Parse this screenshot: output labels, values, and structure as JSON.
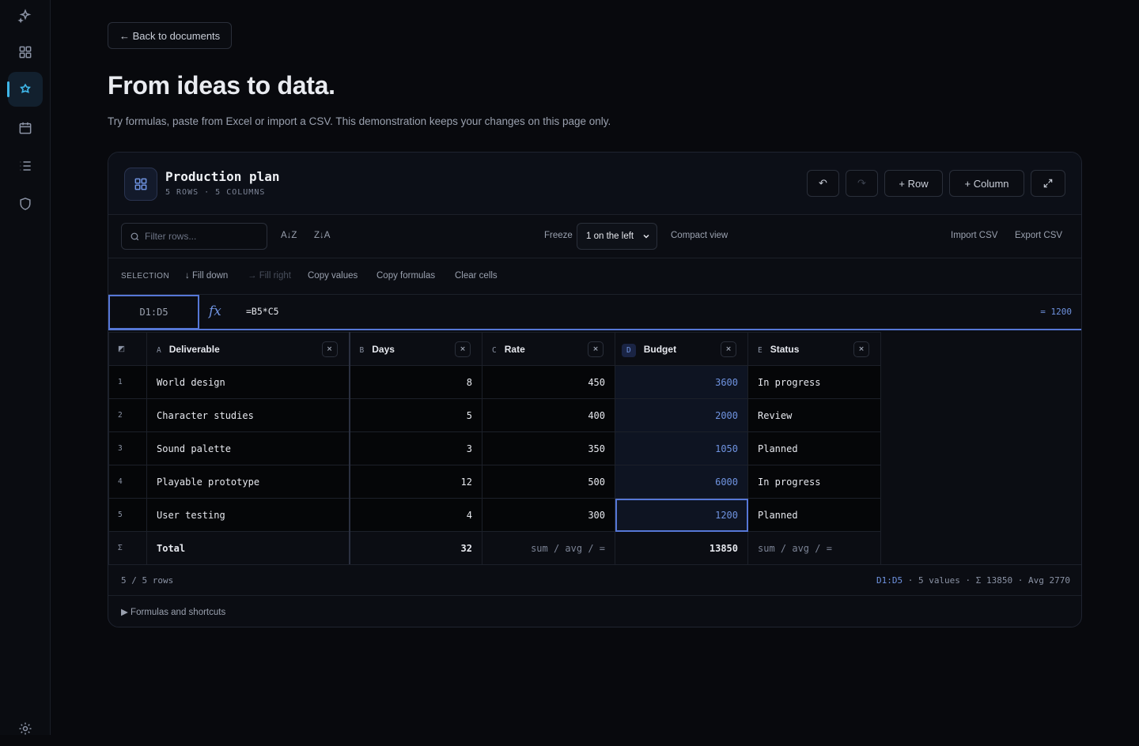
{
  "sidebar": {
    "items": [
      {
        "name": "sparkle-icon"
      },
      {
        "name": "grid-icon"
      },
      {
        "name": "flower-icon",
        "active": true
      },
      {
        "name": "calendar-icon"
      },
      {
        "name": "list-icon"
      },
      {
        "name": "shield-icon"
      },
      {
        "name": "settings-icon"
      }
    ]
  },
  "header": {
    "back_label": "← Back to documents",
    "title": "From ideas to data.",
    "subtitle": "Try formulas, paste from Excel or import a CSV. This demonstration keeps your changes on this page only."
  },
  "doc": {
    "title": "Production plan",
    "meta": "5 ROWS · 5 COLUMNS",
    "undo_icon": "undo-icon",
    "redo_icon": "redo-icon",
    "add_row_label": "+ Row",
    "add_column_label": "+ Column",
    "expand_icon": "expand-icon"
  },
  "toolbar": {
    "filter_placeholder": "Filter rows...",
    "sort_asc": "A↓Z",
    "sort_desc": "Z↓A",
    "freeze_label": "Freeze",
    "freeze_value": "1 on the left",
    "compact_view": "Compact view",
    "import_csv": "Import CSV",
    "export_csv": "Export CSV"
  },
  "selection": {
    "label": "SELECTION",
    "fill_down": "↓ Fill down",
    "fill_right": "→ Fill right",
    "copy_values": "Copy values",
    "copy_formulas": "Copy formulas",
    "clear_cells": "Clear cells"
  },
  "formula": {
    "cell_ref": "D1:D5",
    "fx": "fx",
    "expression": "=B5*C5",
    "result": "= 1200"
  },
  "table": {
    "columns": [
      {
        "letter": "A",
        "name": "Deliverable",
        "remove": "×"
      },
      {
        "letter": "B",
        "name": "Days",
        "remove": "×"
      },
      {
        "letter": "C",
        "name": "Rate",
        "remove": "×"
      },
      {
        "letter": "D",
        "name": "Budget",
        "remove": "×"
      },
      {
        "letter": "E",
        "name": "Status",
        "remove": "×"
      }
    ],
    "rows": [
      {
        "n": "1",
        "deliverable": "World design",
        "days": "8",
        "rate": "450",
        "budget": "3600",
        "status": "In progress"
      },
      {
        "n": "2",
        "deliverable": "Character studies",
        "days": "5",
        "rate": "400",
        "budget": "2000",
        "status": "Review"
      },
      {
        "n": "3",
        "deliverable": "Sound palette",
        "days": "3",
        "rate": "350",
        "budget": "1050",
        "status": "Planned"
      },
      {
        "n": "4",
        "deliverable": "Playable prototype",
        "days": "12",
        "rate": "500",
        "budget": "6000",
        "status": "In progress"
      },
      {
        "n": "5",
        "deliverable": "User testing",
        "days": "4",
        "rate": "300",
        "budget": "1200",
        "status": "Planned"
      }
    ],
    "total": {
      "symbol": "Σ",
      "label": "Total",
      "days": "32",
      "rate": "sum / avg / =",
      "budget": "13850",
      "status": "sum / avg / ="
    }
  },
  "footer": {
    "rows_count": "5 / 5 rows",
    "range": "D1:D5",
    "stats": " · 5 values · Σ 13850 · Avg 2770",
    "shortcuts": "▶ Formulas and shortcuts"
  },
  "colors": {
    "accent": "#6f93e0",
    "sidebar_active": "#3fb6e8",
    "background": "#08090d"
  }
}
